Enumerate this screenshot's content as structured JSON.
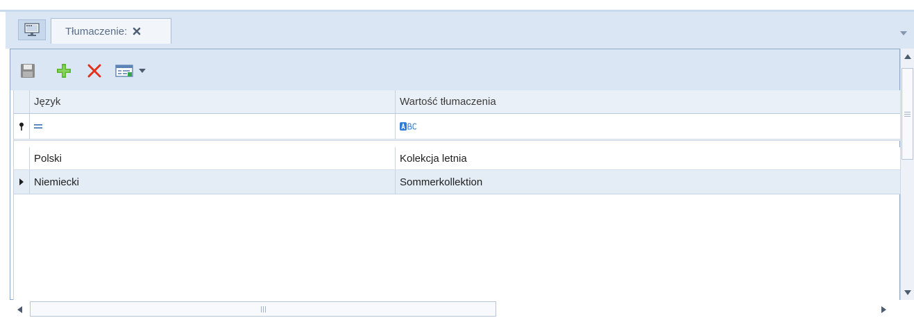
{
  "tab": {
    "label": "Tłumaczenie:",
    "icon": "monitor-icon",
    "close_icon": "close-icon"
  },
  "toolbar": {
    "buttons": [
      {
        "name": "save",
        "icon": "save-icon",
        "color": "#7a7a7a"
      },
      {
        "name": "add",
        "icon": "plus-icon",
        "color": "#58b62f"
      },
      {
        "name": "delete",
        "icon": "x-icon",
        "color": "#e0321c"
      },
      {
        "name": "view",
        "icon": "grid-view-icon"
      }
    ]
  },
  "grid": {
    "columns": [
      "Język",
      "Wartość tłumaczenia"
    ],
    "filter_row": {
      "language_operator_icon": "equals-operator-icon",
      "translation_operator_icon": "text-operator-icon"
    },
    "rows": [
      {
        "language": "Polski",
        "translation": "Kolekcja letnia",
        "selected": false
      },
      {
        "language": "Niemiecki",
        "translation": "Sommerkollektion",
        "selected": true
      }
    ]
  },
  "colors": {
    "chrome": "#dbe6f4",
    "selected_row": "#e4ecf6",
    "border": "#8fa6c4"
  }
}
